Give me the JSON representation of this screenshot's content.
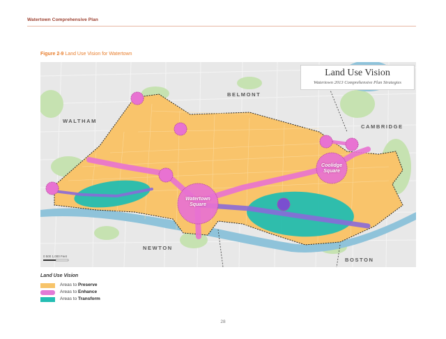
{
  "header": {
    "title": "Watertown Comprehensive Plan"
  },
  "figure": {
    "number": "Figure 2-9",
    "caption": "Land Use Vision for Watertown"
  },
  "map": {
    "title": "Land Use Vision",
    "subtitle": "Watertown 2013 Comprehensive Plan Strategies",
    "towns": {
      "belmont": "BELMONT",
      "waltham": "WALTHAM",
      "cambridge": "CAMBRIDGE",
      "newton": "NEWTON",
      "boston": "BOSTON"
    },
    "squares": {
      "watertown_line1": "Watertown",
      "watertown_line2": "Square",
      "coolidge_line1": "Coolidge",
      "coolidge_line2": "Square"
    },
    "scale_label": "0  500 1,000      Feet"
  },
  "legend": {
    "title": "Land Use Vision",
    "items": [
      {
        "prefix": "Areas to ",
        "bold": "Preserve",
        "color": "#f7c46a"
      },
      {
        "prefix": "Areas to ",
        "bold": "Enhance",
        "color": "#e27ad6"
      },
      {
        "prefix": "Areas to ",
        "bold": "Transform",
        "color": "#24bdb3"
      }
    ]
  },
  "colors": {
    "preserve": "#f9c46b",
    "enhance": "#e872d2",
    "transform": "#1fbcb2",
    "corridor": "#8a6ad8",
    "water": "#8fc3da",
    "open_space": "#c7e3b4",
    "base": "#e7e7e7"
  },
  "page": {
    "number": "28"
  }
}
